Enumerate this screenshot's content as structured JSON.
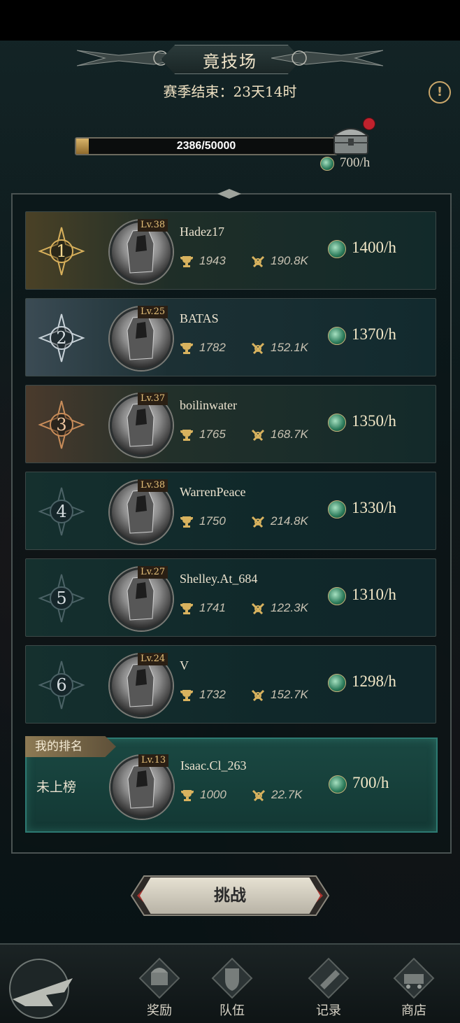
{
  "header": {
    "title": "竟技场",
    "season_label": "赛季结束：23天14时",
    "info_icon": "info-icon"
  },
  "progress": {
    "value": 2386,
    "max": 50000,
    "text": "2386/50000",
    "rate": "700/h"
  },
  "players": [
    {
      "rank": "1",
      "level": "Lv.38",
      "name": "Hadez17",
      "trophies": "1943",
      "power": "190.8K",
      "income": "1400/h",
      "tier": "gold"
    },
    {
      "rank": "2",
      "level": "Lv.25",
      "name": "BATAS",
      "trophies": "1782",
      "power": "152.1K",
      "income": "1370/h",
      "tier": "silver"
    },
    {
      "rank": "3",
      "level": "Lv.37",
      "name": "boilinwater",
      "trophies": "1765",
      "power": "168.7K",
      "income": "1350/h",
      "tier": "bronze"
    },
    {
      "rank": "4",
      "level": "Lv.38",
      "name": "WarrenPeace",
      "trophies": "1750",
      "power": "214.8K",
      "income": "1330/h",
      "tier": "normal"
    },
    {
      "rank": "5",
      "level": "Lv.27",
      "name": "Shelley.At_684",
      "trophies": "1741",
      "power": "122.3K",
      "income": "1310/h",
      "tier": "normal"
    },
    {
      "rank": "6",
      "level": "Lv.24",
      "name": "V",
      "trophies": "1732",
      "power": "152.7K",
      "income": "1298/h",
      "tier": "normal"
    }
  ],
  "my_rank": {
    "tag": "我的排名",
    "status": "未上榜",
    "level": "Lv.13",
    "name": "Isaac.Cl_263",
    "trophies": "1000",
    "power": "22.7K",
    "income": "700/h"
  },
  "challenge_button": "挑战",
  "nav": [
    {
      "label": "奖励",
      "icon": "reward-icon"
    },
    {
      "label": "队伍",
      "icon": "team-shield-icon"
    },
    {
      "label": "记录",
      "icon": "scroll-record-icon"
    },
    {
      "label": "商店",
      "icon": "shop-cart-icon"
    }
  ],
  "colors": {
    "accent_gold": "#e6c27a",
    "panel_teal": "#133834",
    "badge_red": "#c0222d"
  }
}
